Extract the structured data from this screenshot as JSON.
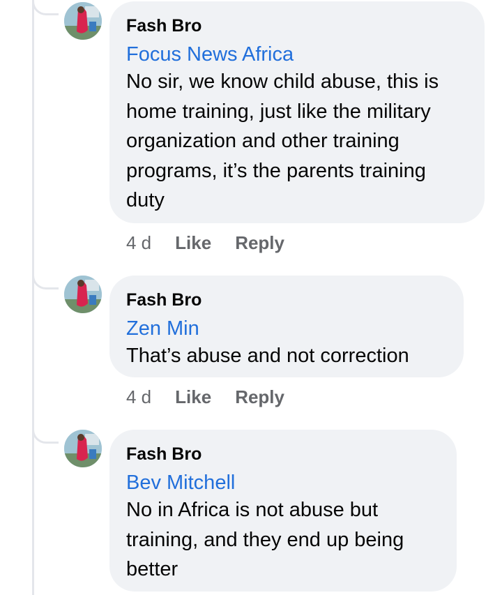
{
  "comments": [
    {
      "author": "Fash Bro",
      "mention": "Focus News Africa",
      "text": "No sir, we know child abuse, this is home training, just like the military organization and other training programs, it’s the parents training duty",
      "time": "4 d",
      "like_label": "Like",
      "reply_label": "Reply"
    },
    {
      "author": "Fash Bro",
      "mention": "Zen Min",
      "text": "That’s abuse and not correction",
      "time": "4 d",
      "like_label": "Like",
      "reply_label": "Reply"
    },
    {
      "author": "Fash Bro",
      "mention": "Bev Mitchell",
      "text": "No in Africa is not abuse but training, and they end up being better"
    }
  ],
  "colors": {
    "bubble_bg": "#f0f2f5",
    "mention_link": "#216fdb",
    "meta_gray": "#65676b",
    "thread_line": "#e4e6eb"
  }
}
